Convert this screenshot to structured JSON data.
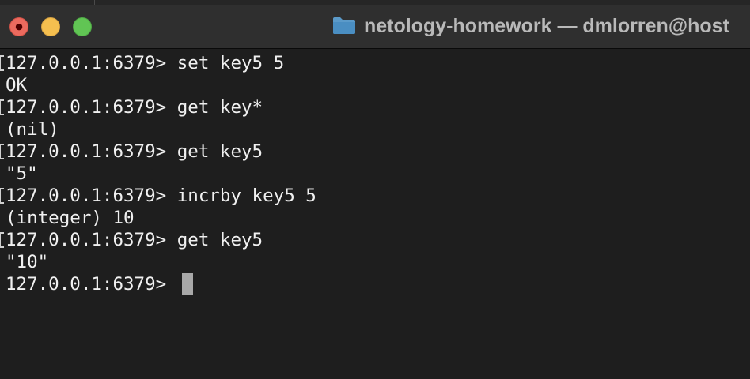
{
  "window": {
    "title": "netology-homework — dmlorren@host",
    "colors": {
      "close": "#ec6a5e",
      "minimize": "#f5bf4f",
      "zoom": "#61c554",
      "background": "#1e1e1e",
      "text": "#f0f0f0"
    },
    "title_icon": "folder-icon"
  },
  "terminal": {
    "lines": [
      {
        "text": "127.0.0.1:6379> set key5 5"
      },
      {
        "text": "OK"
      },
      {
        "text": "127.0.0.1:6379> get key*"
      },
      {
        "text": "(nil)"
      },
      {
        "text": "127.0.0.1:6379> get key5"
      },
      {
        "text": "\"5\""
      },
      {
        "text": "127.0.0.1:6379> incrby key5 5"
      },
      {
        "text": "(integer) 10"
      },
      {
        "text": "127.0.0.1:6379> get key5"
      },
      {
        "text": "\"10\""
      },
      {
        "text": "127.0.0.1:6379> "
      }
    ]
  }
}
